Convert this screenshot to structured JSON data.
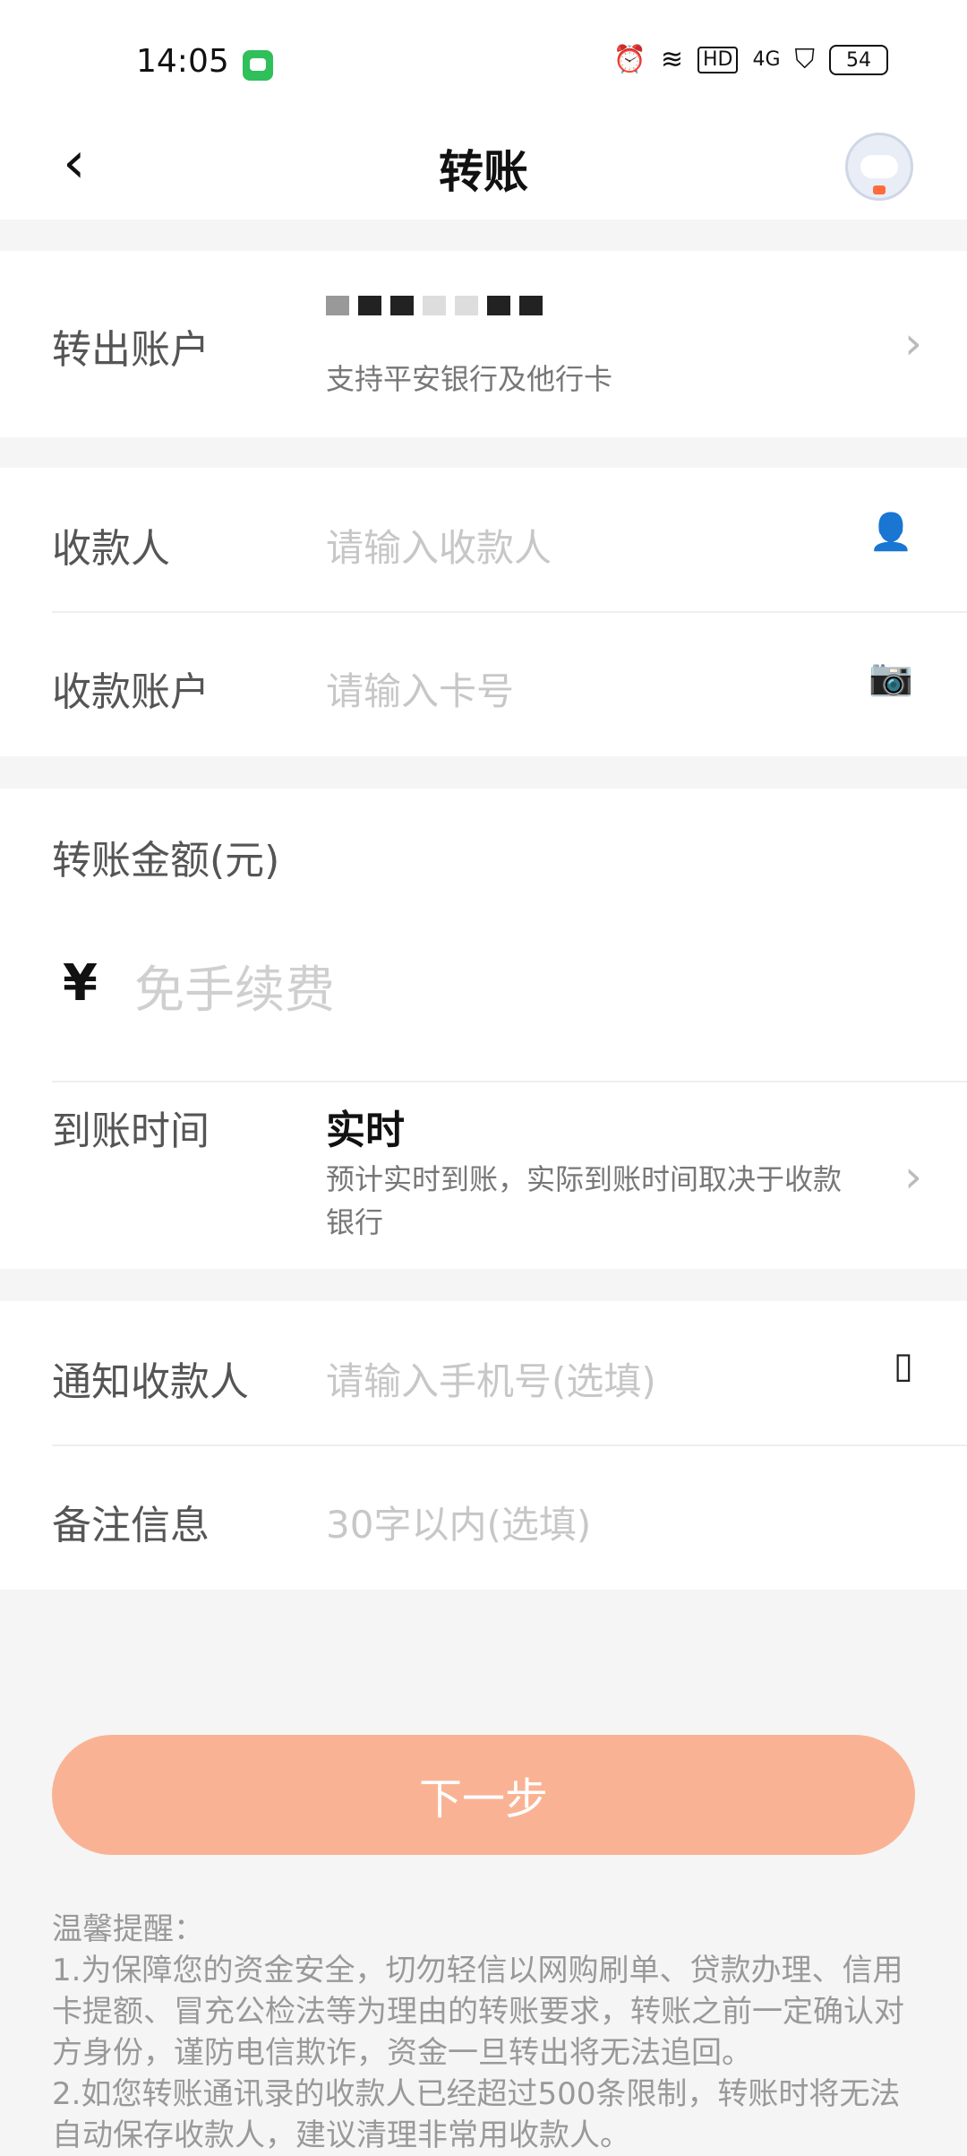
{
  "status_bar": {
    "time": "14:05",
    "network": "4G",
    "hd": "HD",
    "battery": "54"
  },
  "header": {
    "title": "转账",
    "back_icon": "back-arrow-icon",
    "assistant_icon": "mascot-avatar-icon"
  },
  "from_account": {
    "label": "转出账户",
    "sub": "支持平安银行及他行卡"
  },
  "payee": {
    "label": "收款人",
    "placeholder": "请输入收款人"
  },
  "payee_account": {
    "label": "收款账户",
    "placeholder": "请输入卡号"
  },
  "amount": {
    "label": "转账金额(元)",
    "currency_symbol": "¥",
    "placeholder": "免手续费"
  },
  "arrival": {
    "label": "到账时间",
    "value": "实时",
    "desc": "预计实时到账，实际到账时间取决于收款银行"
  },
  "notify": {
    "label": "通知收款人",
    "placeholder": "请输入手机号(选填)"
  },
  "remark": {
    "label": "备注信息",
    "placeholder": "30字以内(选填)"
  },
  "next_button": "下一步",
  "notice": {
    "title": "温馨提醒：",
    "items": [
      "1.为保障您的资金安全，切勿轻信以网购刷单、贷款办理、信用卡提额、冒充公检法等为理由的转账要求，转账之前一定确认对方身份，谨防电信欺诈，资金一旦转出将无法追回。",
      "2.如您转账通讯录的收款人已经超过500条限制，转账时将无法自动保存收款人，建议清理非常用收款人。"
    ]
  },
  "colors": {
    "primary_button": "#f9b394",
    "background": "#f5f5f5"
  }
}
